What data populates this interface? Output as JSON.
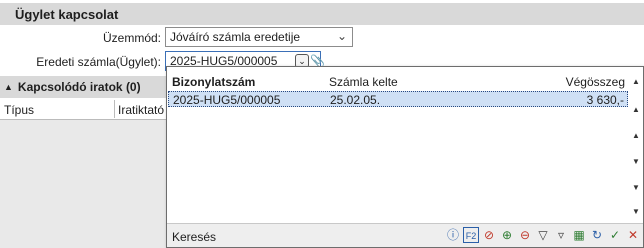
{
  "section_kapcsolat": {
    "title": "Ügylet kapcsolat"
  },
  "form": {
    "uzemmod_label": "Üzemmód:",
    "uzemmod_value": "Jóváíró számla eredetije",
    "eredeti_label": "Eredeti számla(Ügylet):",
    "eredeti_value": "2025-HUG5/000005"
  },
  "section_iratok": {
    "title": "Kapcsolódó iratok (0)",
    "col1": "Típus",
    "col2": "Iratiktató"
  },
  "popup": {
    "headers": [
      "Bizonylatszám",
      "Számla kelte",
      "Végösszeg"
    ],
    "row": {
      "bizonylatszam": "2025-HUG5/000005",
      "kelte": "25.02.05.",
      "vegosszeg": "3 630,-"
    },
    "footer_label": "Keresés",
    "tools": [
      "help-icon",
      "f2-icon",
      "cancel-filter-icon",
      "filter-add-icon",
      "filter-remove-icon",
      "filter-icon",
      "filter-clear-icon",
      "columns-icon",
      "refresh-icon",
      "ok-icon",
      "close-icon"
    ]
  },
  "colors": {
    "header_bg": "#d9d9d9",
    "selection_bg": "#cfe0f5",
    "accent": "#3b6fb6"
  }
}
